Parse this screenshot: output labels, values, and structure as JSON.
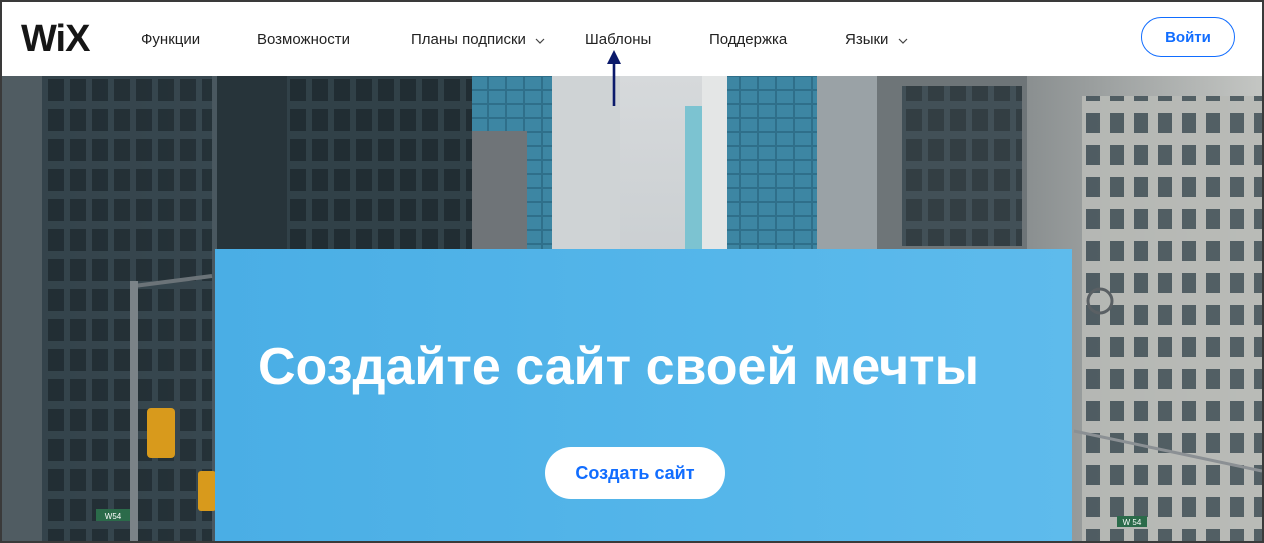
{
  "header": {
    "logo": "WiX",
    "nav": [
      {
        "label": "Функции",
        "dropdown": false
      },
      {
        "label": "Возможности",
        "dropdown": false
      },
      {
        "label": "Планы подписки",
        "dropdown": true
      },
      {
        "label": "Шаблоны",
        "dropdown": false
      },
      {
        "label": "Поддержка",
        "dropdown": false
      },
      {
        "label": "Языки",
        "dropdown": true
      }
    ],
    "login_label": "Войти"
  },
  "hero": {
    "title": "Создайте сайт своей мечты",
    "cta_label": "Создать сайт",
    "street_sign_left": "W54",
    "street_sign_right": "W 54"
  },
  "colors": {
    "accent": "#116dff",
    "promo_blue": "#4aaee5",
    "annotation_arrow": "#0b1a6b"
  }
}
